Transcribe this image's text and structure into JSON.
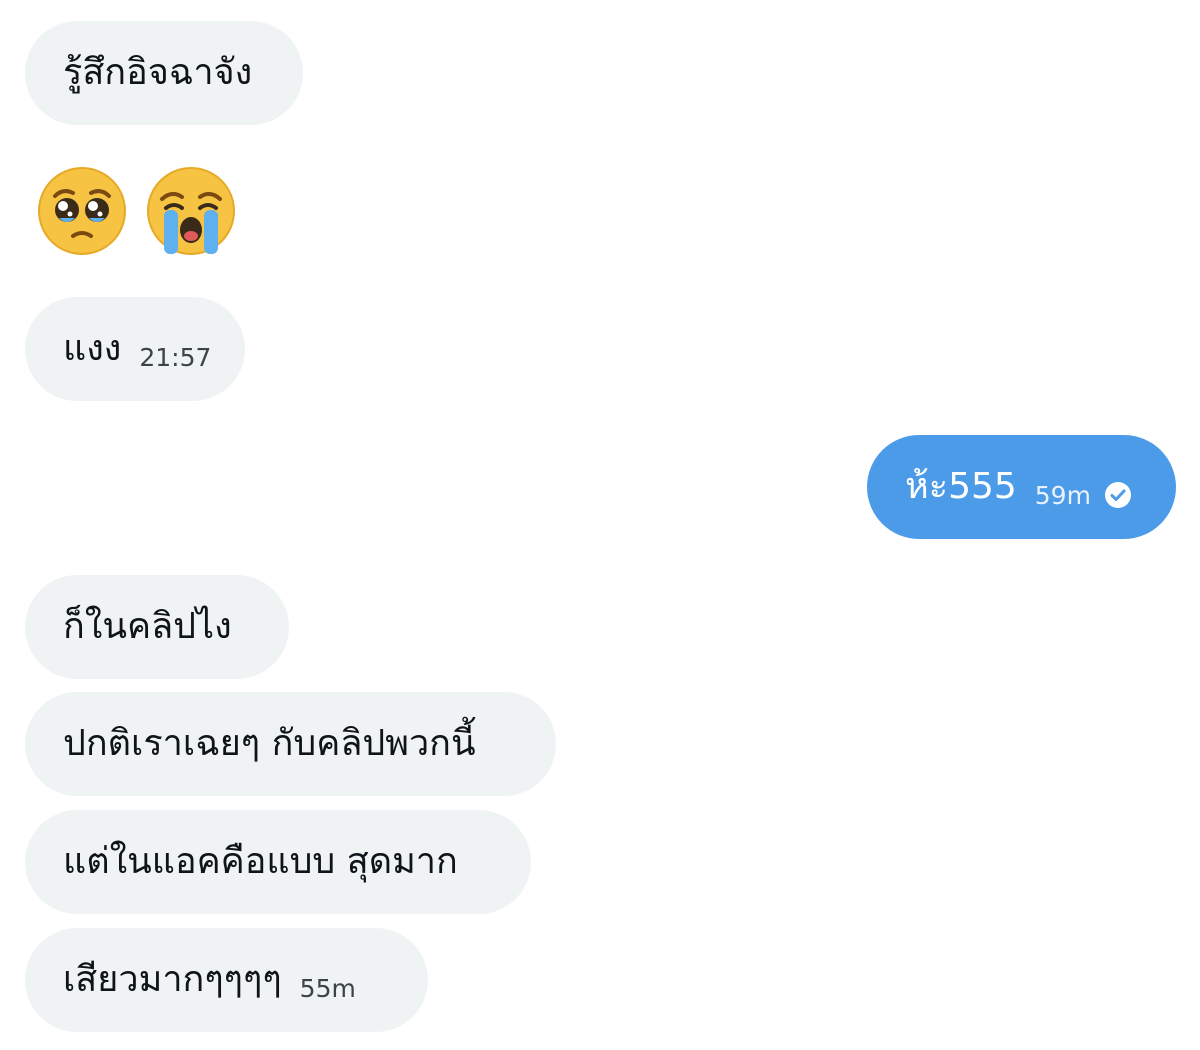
{
  "messages": [
    {
      "text": "รู้สึกอิจฉาจัง",
      "time": "",
      "dir": "in"
    },
    {
      "emoji": [
        "pleading-face-icon",
        "loudly-crying-face-icon"
      ]
    },
    {
      "text": "แงง",
      "time": "21:57",
      "dir": "in"
    },
    {
      "text": "ห้ะ555",
      "time": "59m",
      "dir": "out",
      "status": "read-check-icon"
    },
    {
      "text": "ก็ในคลิปไง",
      "time": "",
      "dir": "in"
    },
    {
      "text": "ปกติเราเฉยๆ กับคลิปพวกนี้",
      "time": "",
      "dir": "in"
    },
    {
      "text": "แต่ในแอคคือแบบ สุดมาก",
      "time": "",
      "dir": "in"
    },
    {
      "text": "เสียวมากๆๆๆๆ",
      "time": "55m",
      "dir": "in"
    }
  ],
  "colors": {
    "incoming_bubble": "#eff3f4",
    "outgoing_bubble": "#4c9be8",
    "text": "#0f1419"
  }
}
